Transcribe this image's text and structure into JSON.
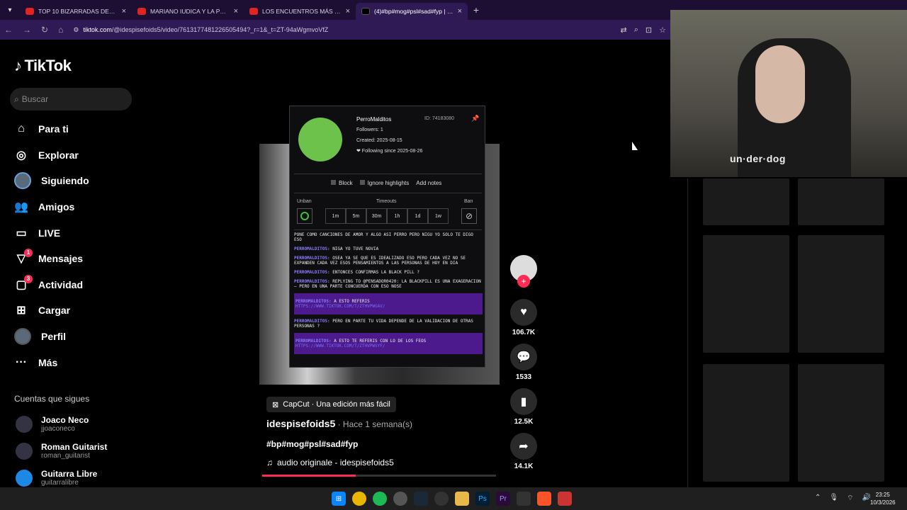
{
  "browser": {
    "tabs": [
      {
        "title": "TOP 10 BIZARRADAS DEL XOKAS"
      },
      {
        "title": "MARIANO IUDICA Y LA PEOR E"
      },
      {
        "title": "LOS ENCUENTROS MÁS EXTRA"
      },
      {
        "title": "(4)#bp#mog#psl#sad#fyp | life"
      }
    ],
    "url_host": "tiktok.com",
    "url_path": "/@idespisefoids5/video/7613177481226505494?_r=1&_t=ZT-94aWgmvoVfZ"
  },
  "tiktok": {
    "logo": "TikTok",
    "search_placeholder": "Buscar",
    "menu": [
      {
        "label": "Para ti",
        "icon": "home-icon"
      },
      {
        "label": "Explorar",
        "icon": "compass-icon"
      },
      {
        "label": "Siguiendo",
        "icon": "following-avatar-icon"
      },
      {
        "label": "Amigos",
        "icon": "friends-icon"
      },
      {
        "label": "LIVE",
        "icon": "live-icon"
      },
      {
        "label": "Mensajes",
        "icon": "messages-icon",
        "badge": "1"
      },
      {
        "label": "Actividad",
        "icon": "activity-icon",
        "badge": "3"
      },
      {
        "label": "Cargar",
        "icon": "upload-icon"
      },
      {
        "label": "Perfil",
        "icon": "profile-icon"
      },
      {
        "label": "Más",
        "icon": "more-icon"
      }
    ],
    "following_heading": "Cuentas que sigues",
    "following": [
      {
        "name": "Joaco Neco",
        "user": "jjoaconeco"
      },
      {
        "name": "Roman Guitarist",
        "user": "roman_guitarist"
      },
      {
        "name": "Guitarra Libre",
        "user": "guitarralibre"
      }
    ]
  },
  "modal": {
    "username": "PerroMalditos",
    "id": "ID: 74183080",
    "followers": "Followers: 1",
    "created": "Created: 2025-08-15",
    "following_since": "❤ Following since 2025-08-26",
    "block": "Block",
    "ignore": "Ignore highlights",
    "add_notes": "Add notes",
    "unban": "Unban",
    "timeouts": "Timeouts",
    "ban": "Ban",
    "timeout_options": [
      "1m",
      "5m",
      "30m",
      "1h",
      "1d",
      "1w"
    ],
    "chat": [
      {
        "user": "",
        "text": "pone como canciones de amor y algo asi perro pero nigu yo solo te digo eso",
        "hl": false
      },
      {
        "user": "PERROMALDITOS:",
        "text": "niga yo tuve novia",
        "hl": false
      },
      {
        "user": "PERROMALDITOS:",
        "text": "osea ya se que es idealizado eso pero cada vez no se expanden cada vez esos pensamientos a las personas de hoy en dia",
        "hl": false
      },
      {
        "user": "PERROMALDITOS:",
        "text": "entonces confirmas la black pill ?",
        "hl": false
      },
      {
        "user": "PERROMALDITOS:",
        "text": "replying to @pensador0420: la blackpill es una exageracion — pero en una parte concuerda con eso nose",
        "hl": false
      },
      {
        "user": "PERROMALDITOS:",
        "text": "a esto referis",
        "link": "https://www.tiktok.com/t/zthvpwgav/",
        "hl": true
      },
      {
        "user": "PERROMALDITOS:",
        "text": "pero en parte tu vida depende de la validacion de otras personas ?",
        "hl": false
      },
      {
        "user": "PERROMALDITOS:",
        "text": "a esto te referis con lo de los feos",
        "link": "https://www.tiktok.com/t/zthvpwsyf/",
        "hl": true
      }
    ]
  },
  "actions": {
    "likes": "106.7K",
    "comments": "1533",
    "saves": "12.5K",
    "shares": "14.1K"
  },
  "video": {
    "capcut": "CapCut · Una edición más fácil",
    "author": "idespisefoids5",
    "ago": " · Hace 1 semana(s)",
    "tags": "#bp#mog#psl#sad#fyp",
    "audio": "audio originale - idespisefoids5",
    "progress": 0.4
  },
  "webcam": {
    "shirt_text": "un·der·dog"
  },
  "taskbar": {
    "time": "23:25",
    "date": "10/3/2026"
  },
  "colors": {
    "accent": "#fe2c55",
    "browser_bg": "#2f1a55",
    "chat_user": "#8a7cff",
    "highlight": "#4c1a8c"
  }
}
